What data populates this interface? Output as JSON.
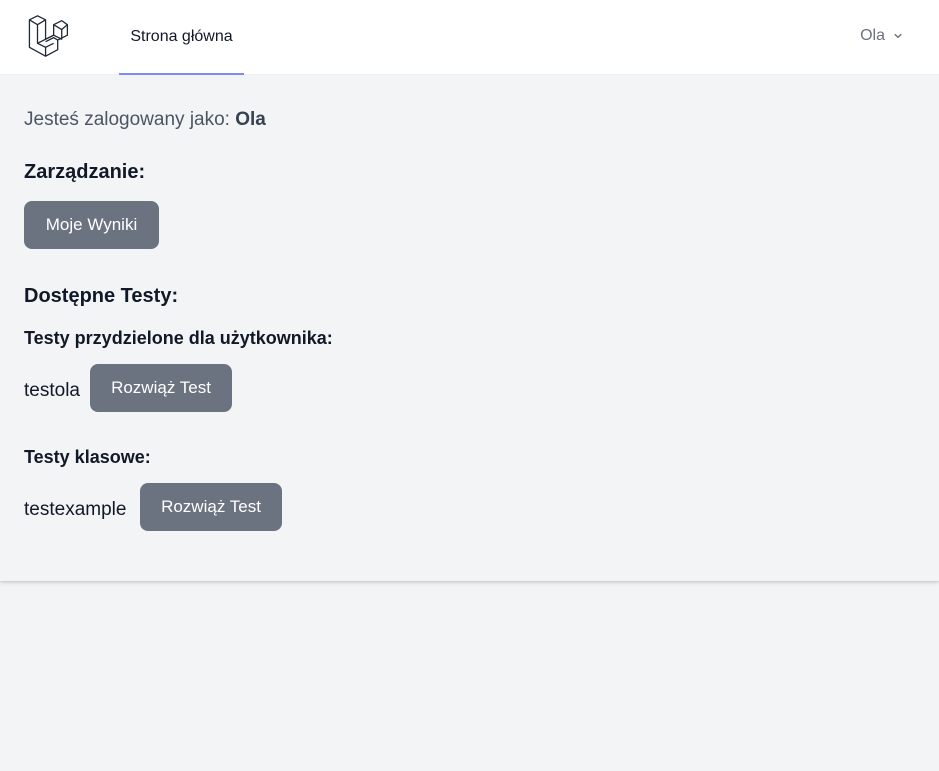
{
  "nav": {
    "logo_icon": "laravel-logo-icon",
    "home_link": "Strona główna",
    "user_name": "Ola",
    "accent_color": "#818cf8"
  },
  "main": {
    "logged_in_prefix": "Jesteś zalogowany jako:",
    "logged_in_user": "Ola",
    "management_heading": "Zarządzanie:",
    "my_results_button": "Moje Wyniki",
    "available_tests_heading": "Dostępne Testy:",
    "user_tests_heading": "Testy przydzielone dla użytkownika:",
    "user_tests": [
      {
        "name": "testola",
        "button": "Rozwiąż Test"
      }
    ],
    "class_tests_heading": "Testy klasowe:",
    "class_tests": [
      {
        "name": "testexample",
        "button": "Rozwiąż Test"
      }
    ],
    "button_color": "#6b7280"
  }
}
